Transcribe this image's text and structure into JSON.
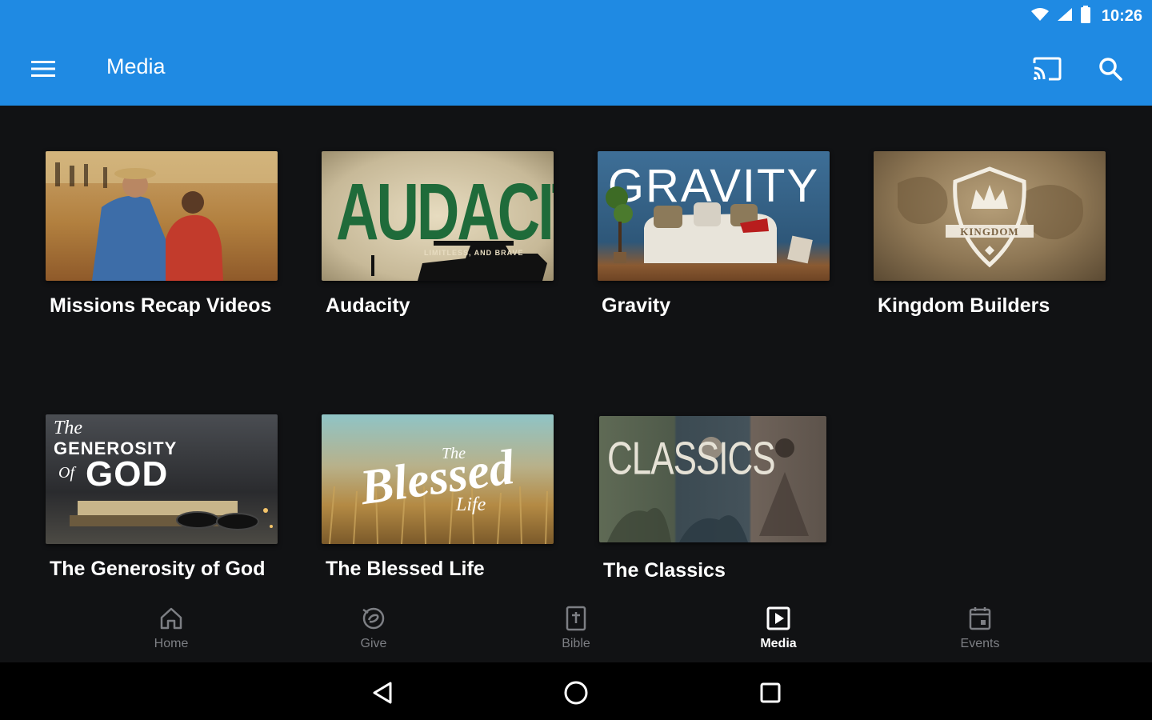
{
  "status_bar": {
    "time": "10:26"
  },
  "toolbar": {
    "title": "Media"
  },
  "media_items": [
    {
      "title": "Missions Recap Videos"
    },
    {
      "title": "Audacity",
      "thumb_text": "AUDACITY",
      "thumb_subtext": "LIMITLESS, AND BRAVE"
    },
    {
      "title": "Gravity",
      "thumb_text": "GRAVITY"
    },
    {
      "title": "Kingdom Builders",
      "thumb_text": "KINGDOM"
    },
    {
      "title": "The Generosity of God",
      "thumb_text_1": "The",
      "thumb_text_2": "GENEROSITY",
      "thumb_text_3": "Of",
      "thumb_text_4": "GOD"
    },
    {
      "title": "The Blessed Life",
      "thumb_text_1": "The",
      "thumb_text_2": "Blessed",
      "thumb_text_3": "Life"
    },
    {
      "title": "The Classics",
      "thumb_text": "CLASSICS"
    }
  ],
  "bottom_nav": [
    {
      "label": "Home",
      "icon": "home-icon"
    },
    {
      "label": "Give",
      "icon": "give-icon"
    },
    {
      "label": "Bible",
      "icon": "bible-icon"
    },
    {
      "label": "Media",
      "icon": "media-icon",
      "active": true
    },
    {
      "label": "Events",
      "icon": "events-icon"
    }
  ],
  "colors": {
    "appbar": "#1f8ae3",
    "background": "#111214",
    "nav_inactive": "#7d7f84",
    "nav_active": "#ffffff"
  }
}
